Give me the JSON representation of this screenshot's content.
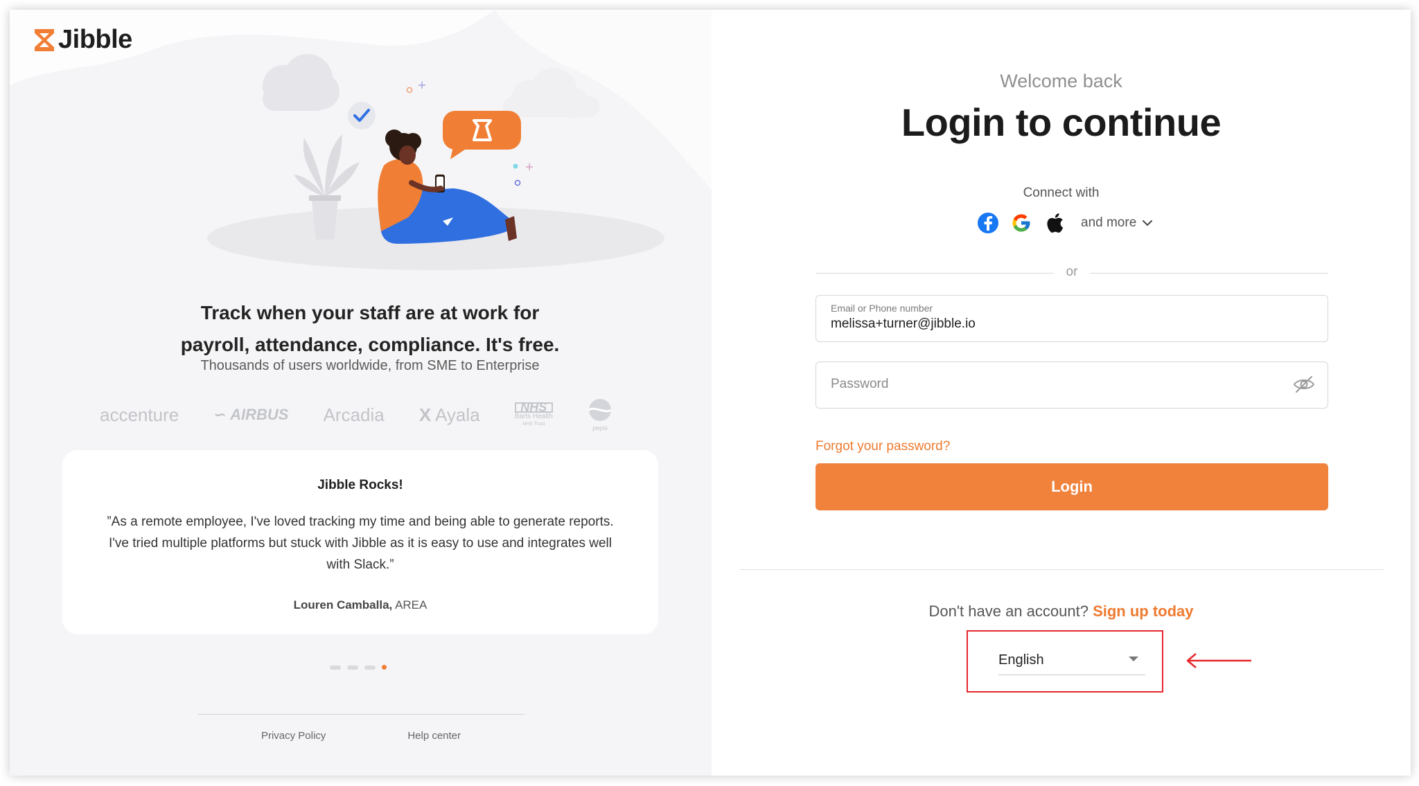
{
  "brand": {
    "name": "Jibble",
    "accent": "#f07f35"
  },
  "left": {
    "headline_line1": "Track when your staff are at work for",
    "headline_line2": "payroll, attendance, compliance. It's free.",
    "subline": "Thousands of users worldwide, from SME to Enterprise",
    "logos": {
      "accenture": "accenture",
      "airbus": "AIRBUS",
      "arcadia": "Arcadia",
      "ayala": "Ayala",
      "nhs": "NHS",
      "nhs_sub1": "Barts Health",
      "nhs_sub2": "NHS Trust",
      "pepsi": "pepsi"
    },
    "testimonial": {
      "title": "Jibble Rocks!",
      "quote": "”As a remote employee, I've loved tracking my time and being able to generate reports. I've tried multiple platforms but stuck with Jibble as it is easy to use and integrates well with Slack.”",
      "author": "Louren Camballa,",
      "company": "AREA"
    },
    "carousel": {
      "count": 4,
      "active_index": 4
    },
    "footer": {
      "privacy": "Privacy Policy",
      "help": "Help center"
    }
  },
  "right": {
    "welcome": "Welcome back",
    "title": "Login to continue",
    "connect_with": "Connect with",
    "socials": [
      "facebook-icon",
      "google-icon",
      "apple-icon"
    ],
    "and_more": "and more",
    "or": "or",
    "email": {
      "label": "Email or Phone number",
      "value": "melissa+turner@jibble.io"
    },
    "password": {
      "placeholder": "Password"
    },
    "forgot": "Forgot your password?",
    "login_button": "Login",
    "no_account": "Don't have an account?",
    "signup": "Sign up today",
    "language": {
      "selected": "English"
    },
    "annotation_color": "#e5262b"
  }
}
